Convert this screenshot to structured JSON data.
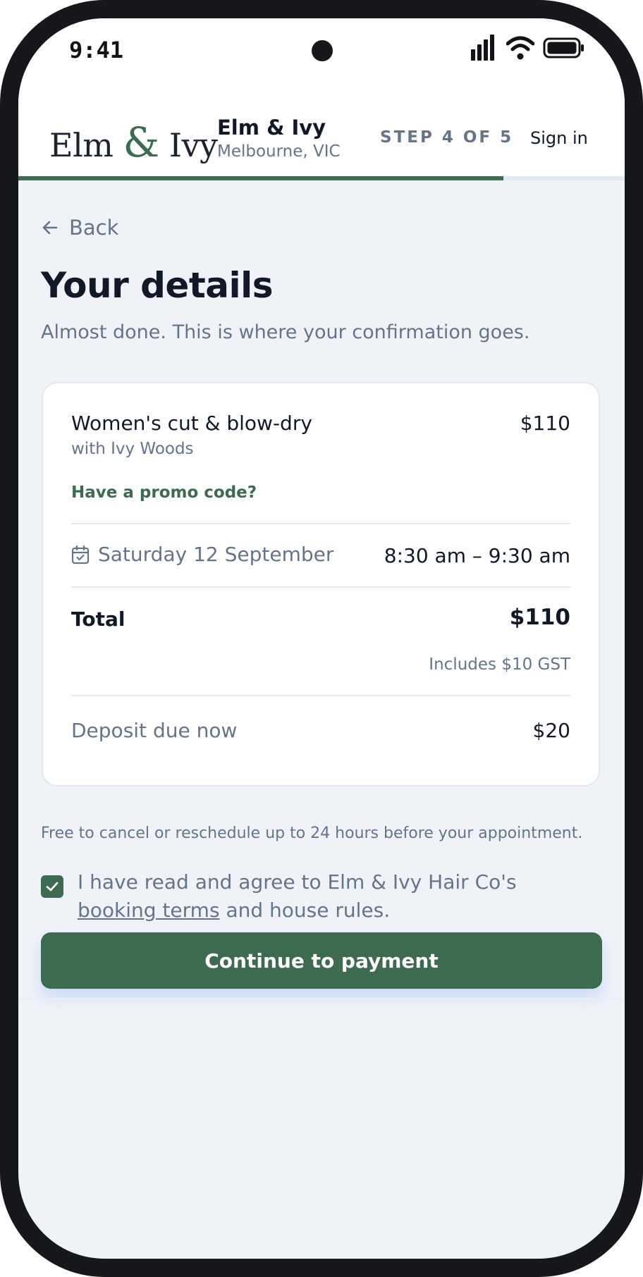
{
  "status_bar": {
    "time": "9:41"
  },
  "header": {
    "logo_left": "Elm",
    "logo_amp": "&",
    "logo_right": "Ivy",
    "shop_name": "Elm & Ivy",
    "shop_location": "Melbourne, VIC",
    "step_label": "STEP 4 OF 5",
    "sign_in": "Sign in",
    "progress": 0.8
  },
  "page": {
    "back_label": "Back",
    "title": "Your details",
    "subtitle": "Almost done. This is where your confirmation goes."
  },
  "summary": {
    "service": "Women's cut & blow-dry",
    "price": "$110",
    "stylist": "with Ivy Woods",
    "promo_link": "Have a promo code?",
    "date": "Saturday 12 September",
    "time_range": "8:30 am – 9:30 am",
    "total_label": "Total",
    "total_value": "$110",
    "gst_note": "Includes $10 GST",
    "deposit_label": "Deposit due now",
    "deposit_value": "$20"
  },
  "policy": {
    "cancel_note": "Free to cancel or reschedule up to 24 hours before your appointment.",
    "agree_prefix": "I have read and agree to Elm & Ivy Hair Co's ",
    "agree_link": "booking terms",
    "agree_suffix": " and house rules.",
    "agreed": true
  },
  "cta": {
    "label": "Continue to payment"
  },
  "colors": {
    "brand_green": "#3d6b4f",
    "background": "#eff3f8",
    "text_dark": "#111827",
    "text_muted": "#64748b",
    "border": "#e2e8f0"
  }
}
